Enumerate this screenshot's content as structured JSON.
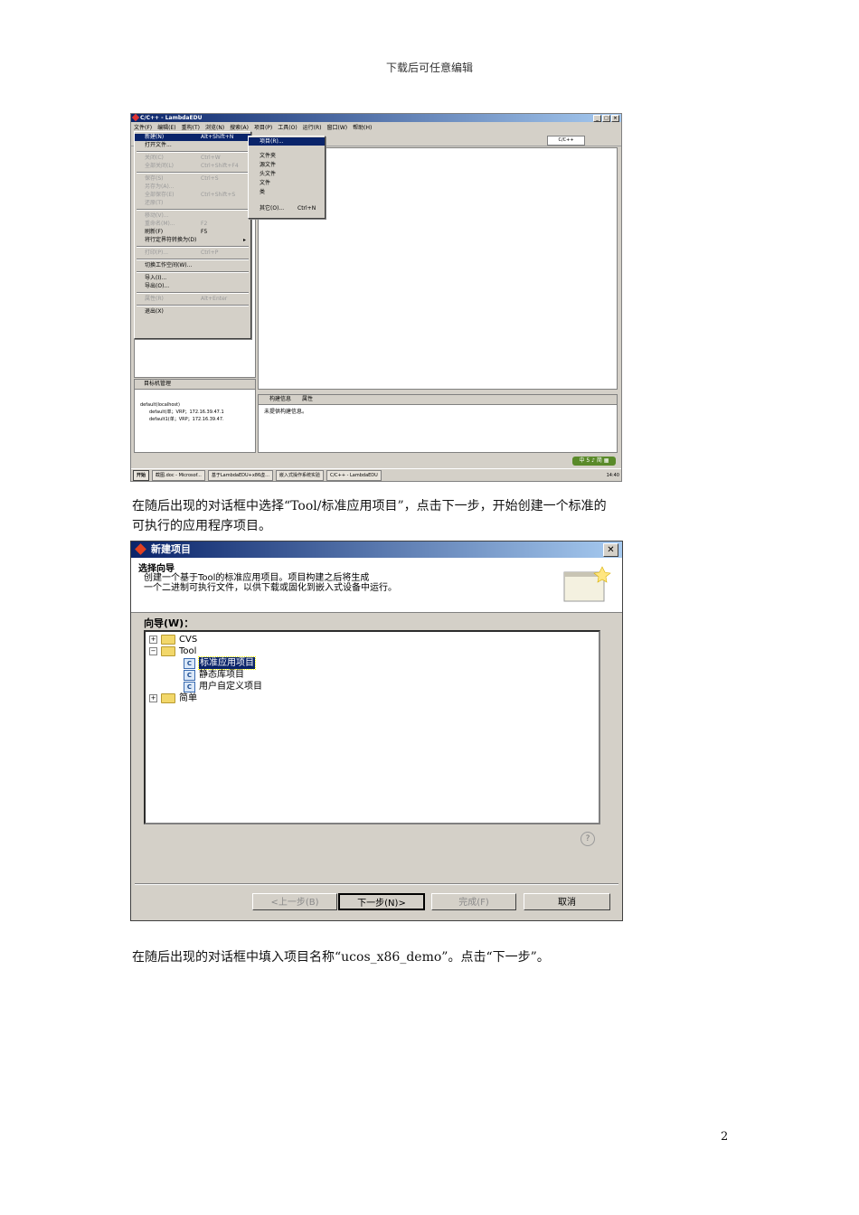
{
  "header": "下载后可任意编辑",
  "paragraph1_line1": "在随后出现的对话框中选择“Tool/标准应用项目”，点击下一步，开始创建一个标准的",
  "paragraph1_line2": "可执行的应用程序项目。",
  "paragraph2": "在随后出现的对话框中填入项目名称“ucos_x86_demo”。点击“下一步”。",
  "page_number": "2",
  "ide": {
    "title": "C/C++ - LambdaEDU",
    "menus": [
      "文件(F)",
      "编辑(E)",
      "重构(T)",
      "浏览(N)",
      "搜索(A)",
      "项目(P)",
      "工具(O)",
      "运行(R)",
      "窗口(W)",
      "帮助(H)"
    ],
    "perspective": "C/C++",
    "file_menu": [
      {
        "label": "新建(N)",
        "accel": "Alt+Shift+N"
      },
      {
        "label": "打开文件...",
        "accel": ""
      },
      {
        "label": "关闭(C)",
        "accel": "Ctrl+W"
      },
      {
        "label": "全部关闭(L)",
        "accel": "Ctrl+Shift+F4"
      },
      {
        "label": "保存(S)",
        "accel": "Ctrl+S"
      },
      {
        "label": "另存为(A)...",
        "accel": ""
      },
      {
        "label": "全部保存(E)",
        "accel": "Ctrl+Shift+S"
      },
      {
        "label": "还原(T)",
        "accel": ""
      },
      {
        "label": "移动(V)...",
        "accel": ""
      },
      {
        "label": "重命名(M)...",
        "accel": "F2"
      },
      {
        "label": "刷新(F)",
        "accel": "F5"
      },
      {
        "label": "将行定界符转换为(D)",
        "accel": "▸"
      },
      {
        "label": "打印(P)...",
        "accel": "Ctrl+P"
      },
      {
        "label": "切换工作空间(W)...",
        "accel": ""
      },
      {
        "label": "导入(I)...",
        "accel": ""
      },
      {
        "label": "导出(O)...",
        "accel": ""
      },
      {
        "label": "属性(R)",
        "accel": "Alt+Enter"
      },
      {
        "label": "退出(X)",
        "accel": ""
      }
    ],
    "new_submenu": [
      {
        "label": "项目(R)...",
        "accel": ""
      },
      {
        "label": "文件夹",
        "accel": ""
      },
      {
        "label": "源文件",
        "accel": ""
      },
      {
        "label": "头文件",
        "accel": ""
      },
      {
        "label": "文件",
        "accel": ""
      },
      {
        "label": "类",
        "accel": ""
      },
      {
        "label": "其它(O)...",
        "accel": "Ctrl+N"
      }
    ],
    "target_panel_title": "目标机管理",
    "target_tree": [
      "default(localhost)",
      "default(单；VRP；172.16.39.47.1",
      "default1(单；VRP；172.16.39.47."
    ],
    "build_tabs": [
      "构建信息",
      "属性"
    ],
    "build_message": "未提供构建信息。",
    "ime_badge": "中 5 ♪ 简 ▦",
    "taskbar": {
      "start": "开始",
      "items": [
        "截图.doc - Microsof...",
        "基于LambdaEDU+x86虚...",
        "嵌入式操作系统实验",
        "C/C++ - LambdaEDU"
      ],
      "tray_time": "14:40"
    }
  },
  "dialog": {
    "title": "新建项目",
    "close_symbol": "✕",
    "heading": "选择向导",
    "description_line1": "创建一个基于Tool的标准应用项目。项目构建之后将生成",
    "description_line2": "一个二进制可执行文件，以供下载或固化到嵌入式设备中运行。",
    "wizard_label": "向导(W)：",
    "tree": [
      {
        "label": "CVS",
        "type": "folder",
        "expander": "+"
      },
      {
        "label": "Tool",
        "type": "folder",
        "expander": "−"
      },
      {
        "label": "标准应用项目",
        "type": "item",
        "selected": true
      },
      {
        "label": "静态库项目",
        "type": "item"
      },
      {
        "label": "用户自定义项目",
        "type": "item"
      },
      {
        "label": "简单",
        "type": "folder",
        "expander": "+"
      }
    ],
    "help_symbol": "?",
    "buttons": {
      "back": "<上一步(B)",
      "next": "下一步(N)>",
      "finish": "完成(F)",
      "cancel": "取消"
    }
  }
}
